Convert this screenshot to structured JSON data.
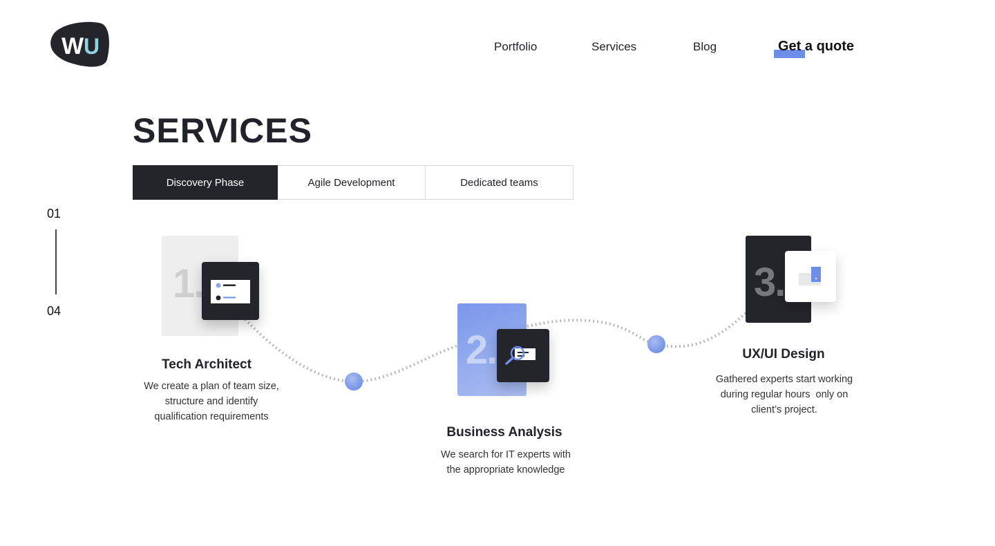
{
  "logo": {
    "text": "WU"
  },
  "nav": {
    "items": [
      "Portfolio",
      "Services",
      "Blog"
    ],
    "cta": "Get a quote"
  },
  "page": {
    "title": "SERVICES"
  },
  "tabs": [
    "Discovery Phase",
    "Agile Development",
    "Dedicated teams"
  ],
  "active_tab": "Discovery Phase",
  "pager": {
    "current": "01",
    "total": "04"
  },
  "steps": [
    {
      "number": "1.",
      "title": "Tech Architect",
      "desc_lines": [
        "We create a plan of team size,",
        "structure and identify",
        "qualification requirements"
      ],
      "icon": "list-card-icon"
    },
    {
      "number": "2.",
      "title": "Business Analysis",
      "desc_lines": [
        "We search for IT experts with",
        "the appropriate knowledge"
      ],
      "icon": "search-card-icon"
    },
    {
      "number": "3.",
      "title": "UX/UI Design",
      "desc_lines": [
        "Gathered experts start working",
        "during regular hours  only on",
        "client’s project."
      ],
      "icon": "device-layout-icon"
    }
  ],
  "colors": {
    "dark": "#24242b",
    "accent": "#6d8ee8",
    "accent_light": "#a9bcef",
    "light_gray": "#eeeeee"
  }
}
